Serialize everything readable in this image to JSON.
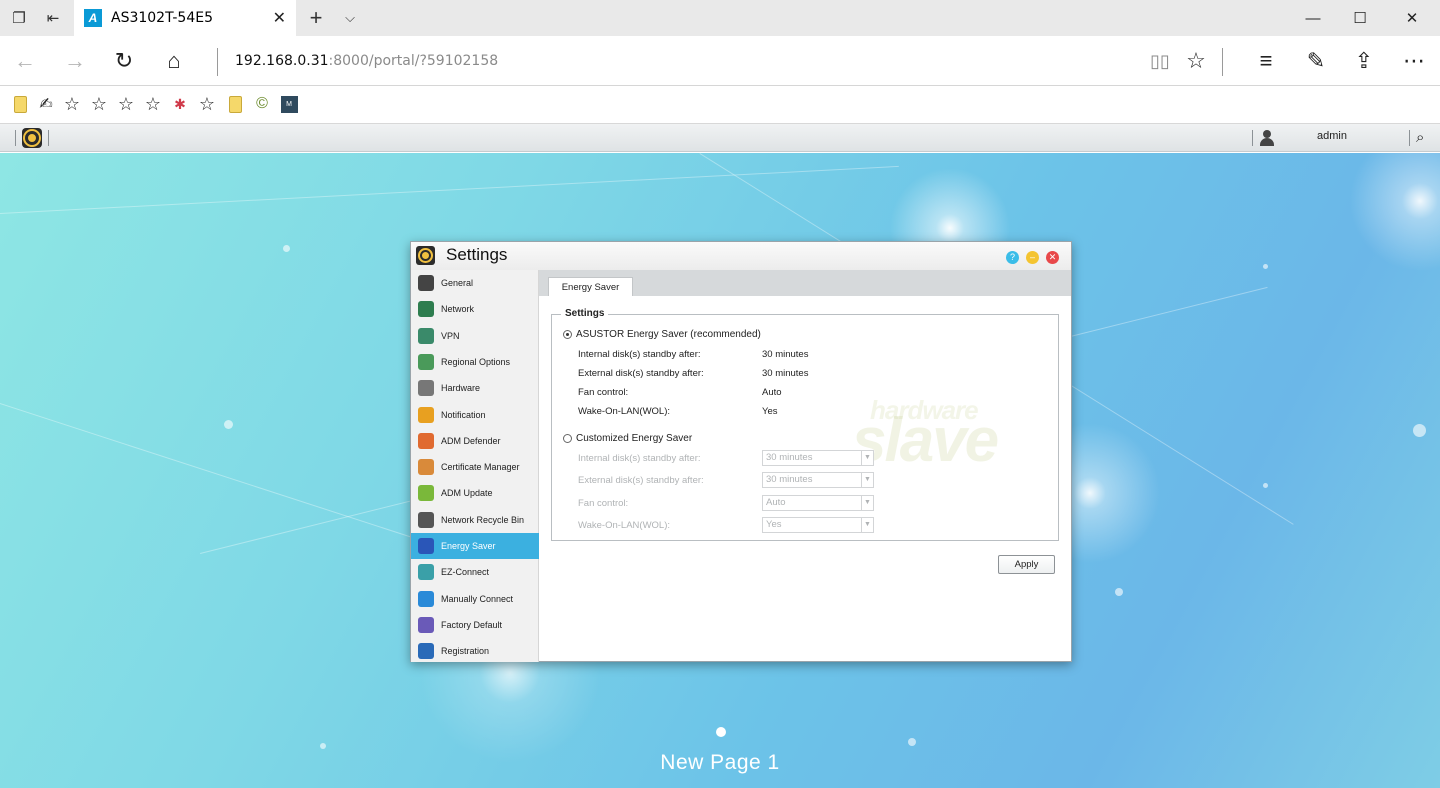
{
  "browser": {
    "tab_title": "AS3102T-54E5",
    "address_host": "192.168.0.31",
    "address_rest": ":8000/portal/?59102158"
  },
  "nas": {
    "user": "admin"
  },
  "settings_window": {
    "title": "Settings",
    "sidebar": [
      {
        "label": "General",
        "icon": "general-icon",
        "color": "#444444"
      },
      {
        "label": "Network",
        "icon": "network-globe-icon",
        "color": "#2e7d4f"
      },
      {
        "label": "VPN",
        "icon": "vpn-icon",
        "color": "#3a8a6a"
      },
      {
        "label": "Regional Options",
        "icon": "globe-clock-icon",
        "color": "#4a9a5a"
      },
      {
        "label": "Hardware",
        "icon": "hardware-icon",
        "color": "#777777"
      },
      {
        "label": "Notification",
        "icon": "notification-icon",
        "color": "#e8a020"
      },
      {
        "label": "ADM Defender",
        "icon": "firewall-icon",
        "color": "#e06a30"
      },
      {
        "label": "Certificate Manager",
        "icon": "certificate-icon",
        "color": "#d98a3a"
      },
      {
        "label": "ADM Update",
        "icon": "update-arrow-icon",
        "color": "#7ab83a"
      },
      {
        "label": "Network Recycle Bin",
        "icon": "recycle-bin-icon",
        "color": "#555555"
      },
      {
        "label": "Energy Saver",
        "icon": "energy-saver-icon",
        "color": "#2a56b8"
      },
      {
        "label": "EZ-Connect",
        "icon": "cloud-connect-icon",
        "color": "#3aa0a8"
      },
      {
        "label": "Manually Connect",
        "icon": "manual-connect-icon",
        "color": "#2a8ad8"
      },
      {
        "label": "Factory Default",
        "icon": "factory-default-icon",
        "color": "#6a5ab8"
      },
      {
        "label": "Registration",
        "icon": "registration-icon",
        "color": "#2a6ab8"
      }
    ],
    "active_tab": "Energy Saver",
    "legend": "Settings",
    "recommended": {
      "label": "ASUSTOR Energy Saver (recommended)",
      "rows": [
        {
          "label": "Internal disk(s) standby after:",
          "value": "30 minutes"
        },
        {
          "label": "External disk(s) standby after:",
          "value": "30 minutes"
        },
        {
          "label": "Fan control:",
          "value": "Auto"
        },
        {
          "label": "Wake-On-LAN(WOL):",
          "value": "Yes"
        }
      ]
    },
    "custom": {
      "label": "Customized Energy Saver",
      "rows": [
        {
          "label": "Internal disk(s) standby after:",
          "value": "30 minutes"
        },
        {
          "label": "External disk(s) standby after:",
          "value": "30 minutes"
        },
        {
          "label": "Fan control:",
          "value": "Auto"
        },
        {
          "label": "Wake-On-LAN(WOL):",
          "value": "Yes"
        }
      ]
    },
    "apply_label": "Apply",
    "watermark_top": "hardware",
    "watermark_main": "slave"
  },
  "desktop": {
    "page_label": "New Page 1"
  }
}
